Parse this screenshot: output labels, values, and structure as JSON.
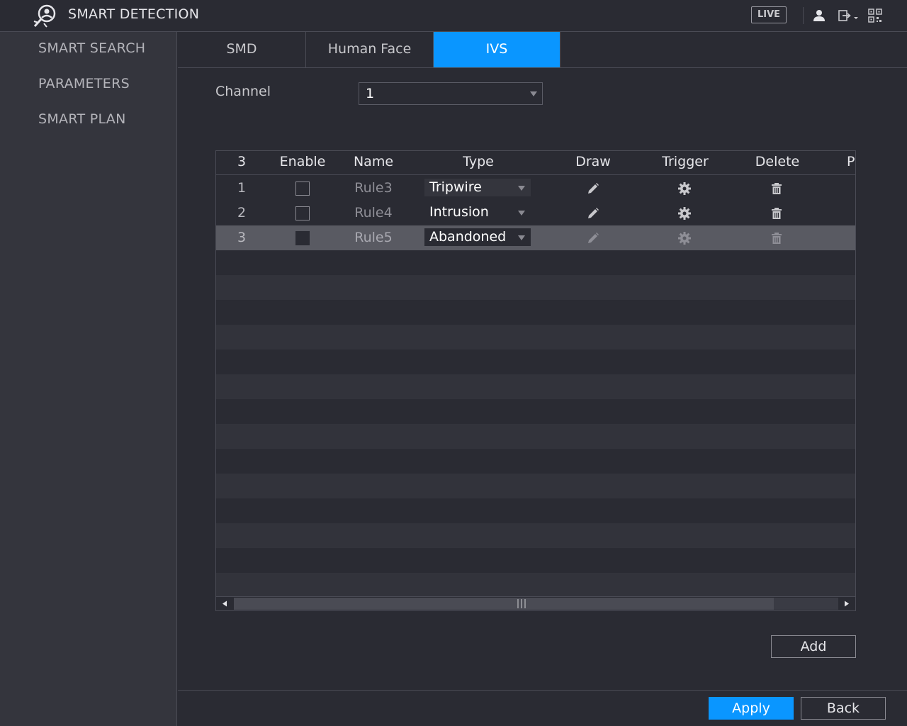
{
  "header": {
    "title": "SMART DETECTION",
    "live_label": "LIVE"
  },
  "sidebar": {
    "items": [
      {
        "label": "SMART SEARCH"
      },
      {
        "label": "PARAMETERS"
      },
      {
        "label": "SMART PLAN"
      }
    ]
  },
  "tabs": [
    {
      "label": "SMD",
      "active": false
    },
    {
      "label": "Human Face",
      "active": false
    },
    {
      "label": "IVS",
      "active": true
    }
  ],
  "channel": {
    "label": "Channel",
    "value": "1"
  },
  "table": {
    "columns": [
      "3",
      "Enable",
      "Name",
      "Type",
      "Draw",
      "Trigger",
      "Delete",
      "P"
    ],
    "rows": [
      {
        "index": "1",
        "enabled": false,
        "name": "Rule3",
        "type": "Tripwire",
        "selected": false
      },
      {
        "index": "2",
        "enabled": false,
        "name": "Rule4",
        "type": "Intrusion",
        "selected": false
      },
      {
        "index": "3",
        "enabled": true,
        "name": "Rule5",
        "type": "Abandoned",
        "selected": true
      }
    ]
  },
  "buttons": {
    "add": "Add",
    "apply": "Apply",
    "back": "Back"
  },
  "colors": {
    "accent": "#0a96ff",
    "background": "#2a2b33",
    "sidebar": "#34353d",
    "selected_row": "#595a62"
  },
  "icons": {
    "logo": "smart-detection-logo-icon",
    "user": "user-icon",
    "logout": "logout-icon",
    "qr": "qr-code-icon",
    "draw": "pencil-icon",
    "trigger": "gear-icon",
    "delete": "trash-icon"
  }
}
